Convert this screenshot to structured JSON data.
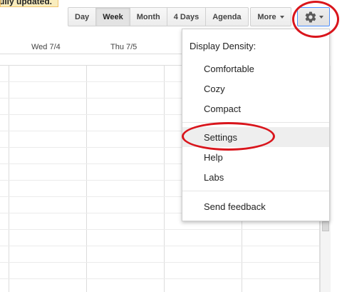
{
  "notice": {
    "text": "ully updated."
  },
  "toolbar": {
    "views": [
      {
        "label": "Day"
      },
      {
        "label": "Week",
        "active": true
      },
      {
        "label": "Month"
      },
      {
        "label": "4 Days"
      },
      {
        "label": "Agenda"
      }
    ],
    "more_label": "More",
    "settings_icon": "gear-icon"
  },
  "calendar": {
    "day_headers": [
      "Wed 7/4",
      "Thu 7/5"
    ]
  },
  "menu": {
    "density_title": "Display Density:",
    "density_options": [
      "Comfortable",
      "Cozy",
      "Compact"
    ],
    "items": [
      "Settings",
      "Help",
      "Labs"
    ],
    "feedback": "Send feedback"
  },
  "colors": {
    "annotation": "#d9151c",
    "highlight": "#eeeeee",
    "focus_border": "#4d90fe"
  }
}
